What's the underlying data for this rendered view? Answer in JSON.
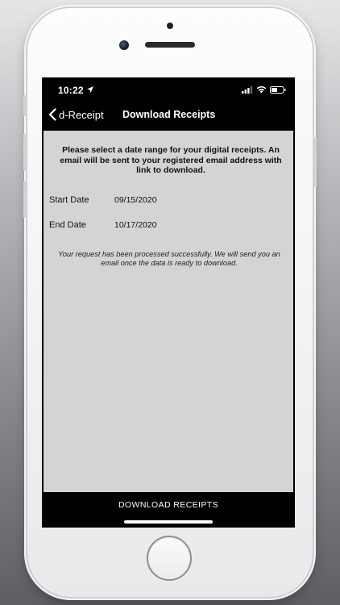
{
  "status_bar": {
    "time": "10:22"
  },
  "nav": {
    "back_label": "d-Receipt",
    "title": "Download Receipts"
  },
  "content": {
    "instructions": "Please select a date range for your digital receipts. An email will be sent to your registered email address with link to download.",
    "start_date_label": "Start Date",
    "start_date_value": "09/15/2020",
    "end_date_label": "End Date",
    "end_date_value": "10/17/2020",
    "success_message": "Your request has been processed successfully. We will send you an email once the data is ready to download."
  },
  "footer": {
    "download_label": "DOWNLOAD RECEIPTS"
  },
  "colors": {
    "background_dark": "#000000",
    "content_background": "#d4d4d4",
    "text_light": "#ffffff",
    "text_dark": "#111111"
  }
}
